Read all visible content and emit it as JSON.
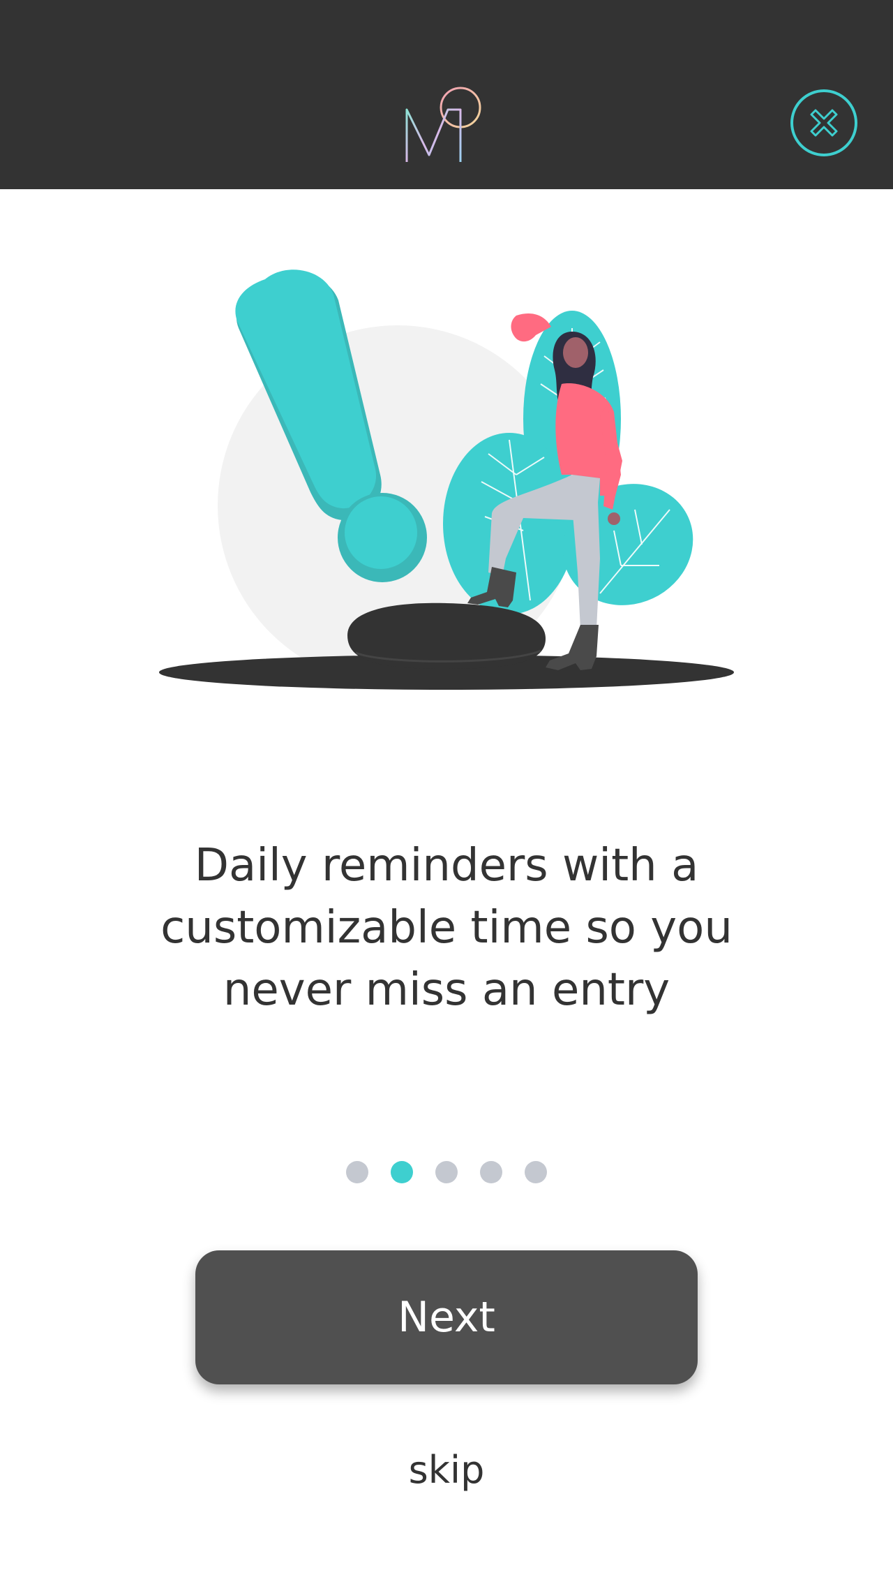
{
  "header": {
    "background_color": "#333333",
    "logo_icon": "mq-monogram-icon",
    "close_icon": "close-circle-icon",
    "accent_color": "#3ecfcf"
  },
  "onboarding": {
    "illustration_icon": "woman-exclamation-reminder-illustration",
    "headline": "Daily reminders with a customizable time so you never miss an entry",
    "pagination": {
      "total": 5,
      "active_index": 1,
      "active_color": "#3ecfcf",
      "inactive_color": "#c4c8d0"
    },
    "next_label": "Next",
    "skip_label": "skip"
  }
}
